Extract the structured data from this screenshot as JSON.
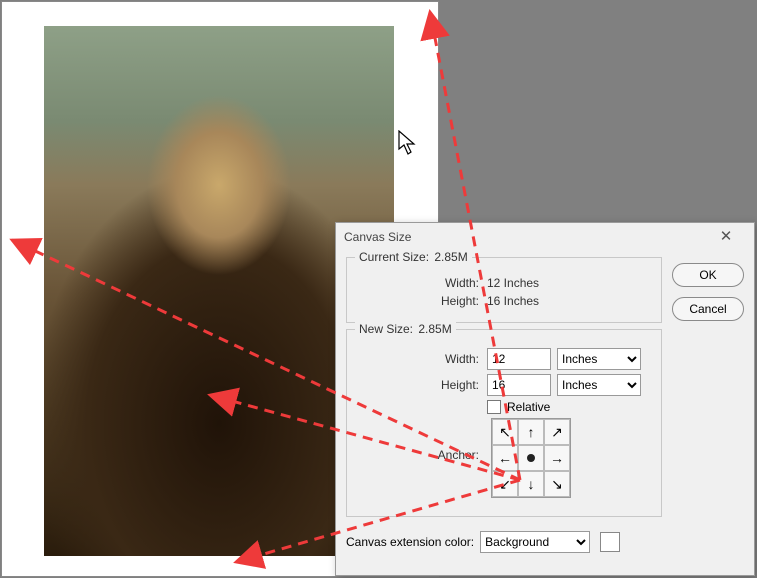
{
  "dialog": {
    "title": "Canvas Size",
    "current": {
      "label": "Current Size:",
      "size_value": "2.85M",
      "width_label": "Width:",
      "width_value": "12 Inches",
      "height_label": "Height:",
      "height_value": "16 Inches"
    },
    "new": {
      "label": "New Size:",
      "size_value": "2.85M",
      "width_label": "Width:",
      "width_value": "12",
      "width_units": "Inches",
      "height_label": "Height:",
      "height_value": "16",
      "height_units": "Inches",
      "relative_label": "Relative",
      "anchor_label": "Anchor:"
    },
    "extension": {
      "label": "Canvas extension color:",
      "value": "Background"
    },
    "buttons": {
      "ok": "OK",
      "cancel": "Cancel"
    },
    "close_glyph": "✕"
  },
  "anchor_arrows": [
    "↖",
    "↑",
    "↗",
    "←",
    "",
    "→",
    "↙",
    "↓",
    "↘"
  ]
}
